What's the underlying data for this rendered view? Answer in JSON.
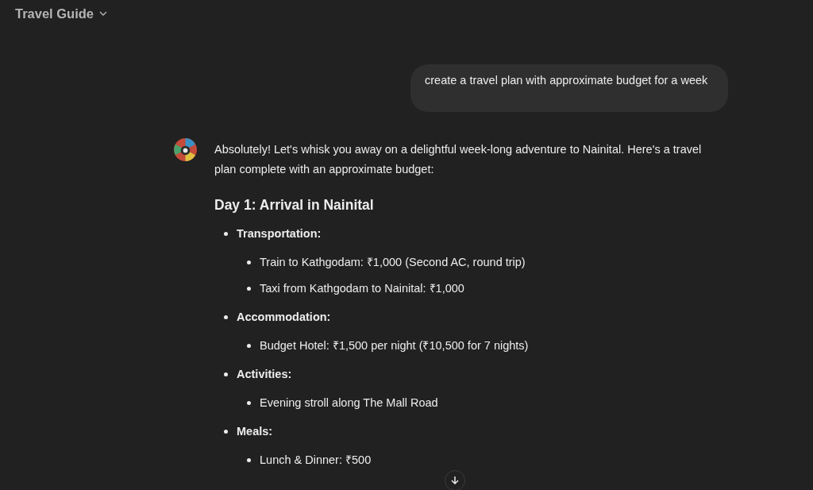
{
  "header": {
    "title": "Travel Guide"
  },
  "user_message": "create a travel plan with approximate budget for a week",
  "assistant": {
    "intro": "Absolutely! Let's whisk you away on a delightful week-long adventure to Nainital. Here's a travel plan complete with an approximate budget:",
    "heading": "Day 1: Arrival in Nainital",
    "sections": [
      {
        "label": "Transportation:",
        "items": [
          "Train to Kathgodam: ₹1,000 (Second AC, round trip)",
          "Taxi from Kathgodam to Nainital: ₹1,000"
        ]
      },
      {
        "label": "Accommodation:",
        "items": [
          "Budget Hotel: ₹1,500 per night (₹10,500 for 7 nights)"
        ]
      },
      {
        "label": "Activities:",
        "items": [
          "Evening stroll along The Mall Road"
        ]
      },
      {
        "label": "Meals:",
        "items": [
          "Lunch & Dinner: ₹500"
        ]
      }
    ]
  }
}
